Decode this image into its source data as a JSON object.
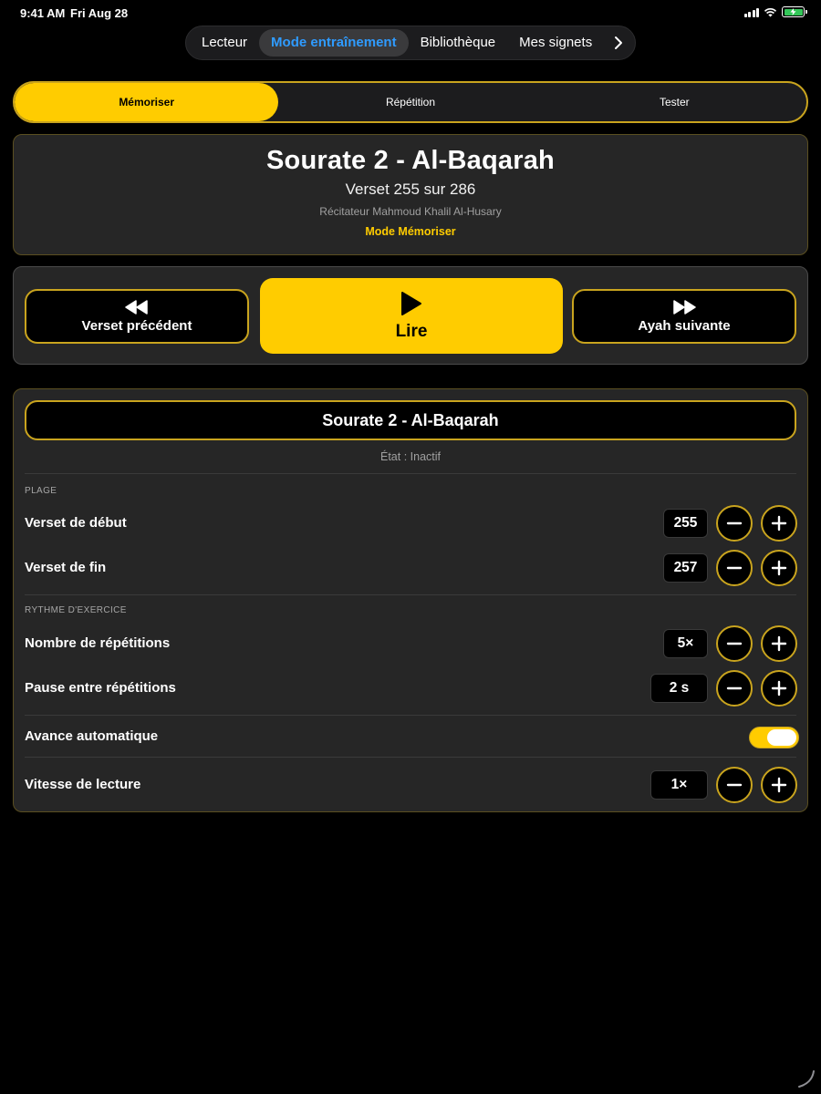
{
  "status_bar": {
    "time": "9:41 AM",
    "date": "Fri Aug 28"
  },
  "top_nav": {
    "items": [
      {
        "label": "Lecteur",
        "active": false
      },
      {
        "label": "Mode entraînement",
        "active": true
      },
      {
        "label": "Bibliothèque",
        "active": false
      },
      {
        "label": "Mes signets",
        "active": false
      }
    ],
    "more_icon": "chevron-right-icon"
  },
  "mode_tabs": [
    {
      "label": "Mémoriser",
      "active": true
    },
    {
      "label": "Répétition",
      "active": false
    },
    {
      "label": "Tester",
      "active": false
    }
  ],
  "info": {
    "title": "Sourate 2 - Al-Baqarah",
    "verse": "Verset 255 sur 286",
    "reciter": "Récitateur Mahmoud Khalil Al-Husary",
    "mode": "Mode Mémoriser"
  },
  "player": {
    "prev_label": "Verset précédent",
    "play_label": "Lire",
    "next_label": "Ayah suivante"
  },
  "settings": {
    "title": "Sourate 2 - Al-Baqarah",
    "status": "État : Inactif",
    "range_header": "PLAGE",
    "start_label": "Verset de début",
    "start_value": "255",
    "end_label": "Verset de fin",
    "end_value": "257",
    "rhythm_header": "RYTHME D'EXERCICE",
    "reps_label": "Nombre de répétitions",
    "reps_value": "5×",
    "pause_label": "Pause entre répétitions",
    "pause_value": "2 s",
    "auto_label": "Avance automatique",
    "auto_on": true,
    "speed_label": "Vitesse de lecture",
    "speed_value": "1×"
  },
  "colors": {
    "accent": "#ffcc00",
    "border": "#c9a41e",
    "link": "#2f9bff",
    "card": "#262626"
  }
}
